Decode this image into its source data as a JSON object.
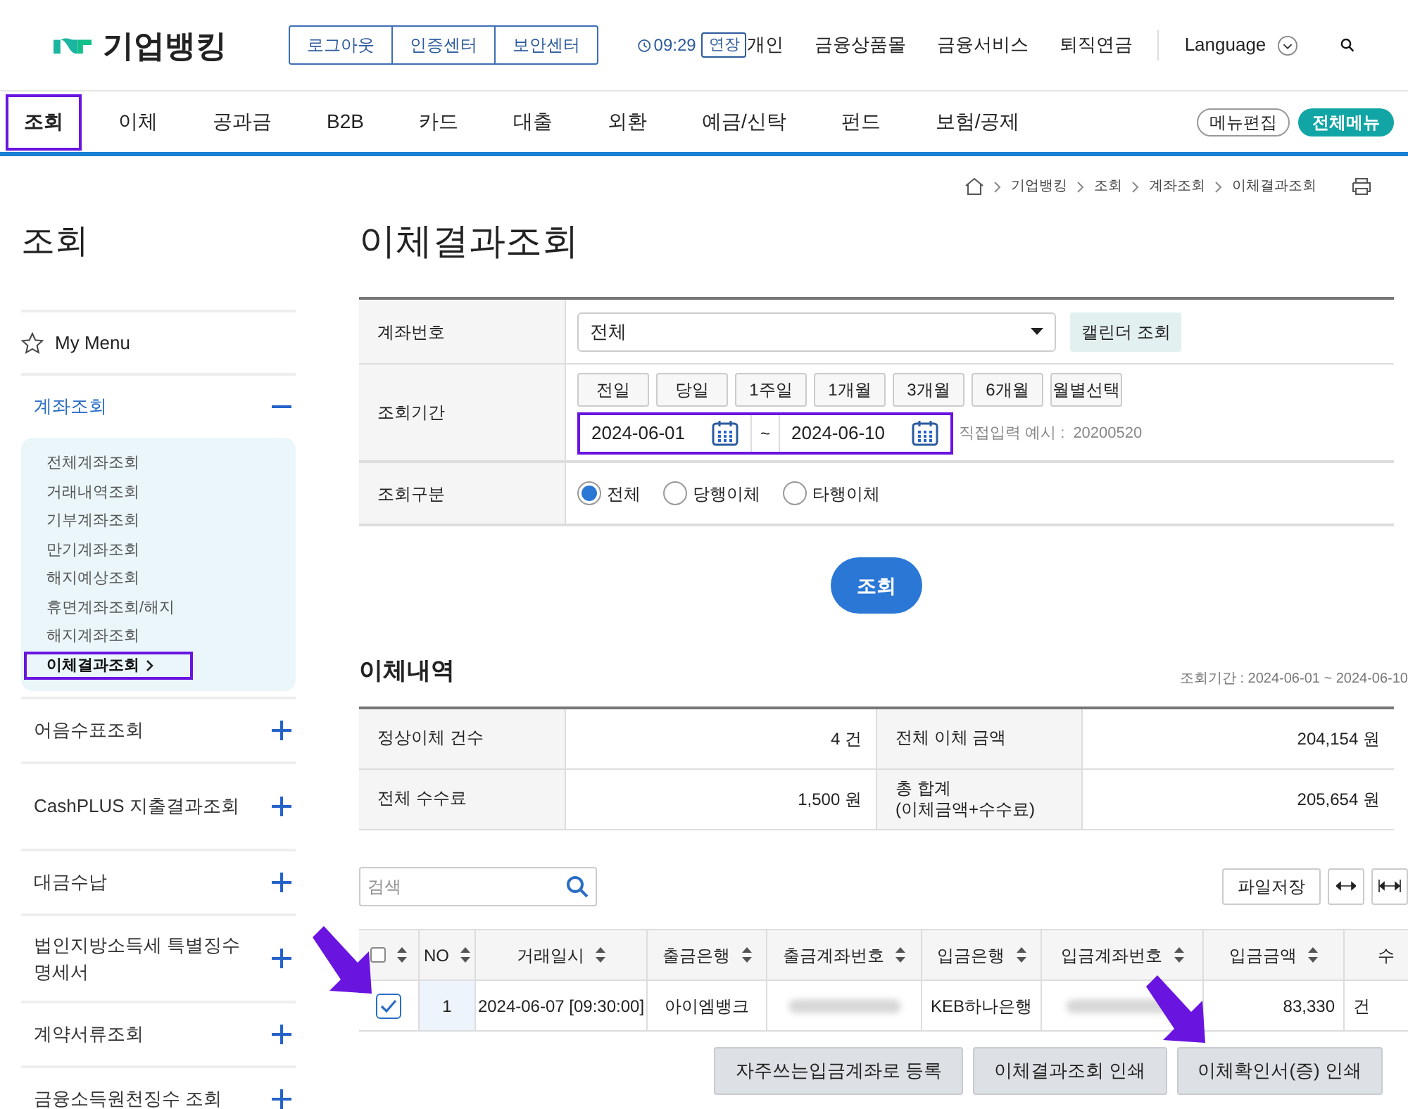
{
  "header": {
    "logo_text": "기업뱅킹",
    "session_buttons": [
      "로그아웃",
      "인증센터",
      "보안센터"
    ],
    "timer": "09:29",
    "extend": "연장",
    "links": [
      "개인",
      "금융상품몰",
      "금융서비스",
      "퇴직연금"
    ],
    "language": "Language"
  },
  "nav": {
    "tabs": [
      {
        "label": "조회",
        "selected": true,
        "highlighted": true
      },
      {
        "label": "이체",
        "selected": false,
        "highlighted": false
      },
      {
        "label": "공과금",
        "selected": false,
        "highlighted": false
      },
      {
        "label": "B2B",
        "selected": false,
        "highlighted": false
      },
      {
        "label": "카드",
        "selected": false,
        "highlighted": false
      },
      {
        "label": "대출",
        "selected": false,
        "highlighted": false
      },
      {
        "label": "외환",
        "selected": false,
        "highlighted": false
      },
      {
        "label": "예금/신탁",
        "selected": false,
        "highlighted": false
      },
      {
        "label": "펀드",
        "selected": false,
        "highlighted": false
      },
      {
        "label": "보험/공제",
        "selected": false,
        "highlighted": false
      }
    ],
    "edit_menu": "메뉴편집",
    "all_menu": "전체메뉴"
  },
  "breadcrumb": [
    "기업뱅킹",
    "조회",
    "계좌조회",
    "이체결과조회"
  ],
  "sidebar": {
    "title": "조회",
    "my_menu": "My Menu",
    "sections": [
      {
        "label": "계좌조회",
        "expanded": true,
        "children": [
          {
            "label": "전체계좌조회",
            "selected": false,
            "highlighted": false
          },
          {
            "label": "거래내역조회",
            "selected": false,
            "highlighted": false
          },
          {
            "label": "기부계좌조회",
            "selected": false,
            "highlighted": false
          },
          {
            "label": "만기계좌조회",
            "selected": false,
            "highlighted": false
          },
          {
            "label": "해지예상조회",
            "selected": false,
            "highlighted": false
          },
          {
            "label": "휴면계좌조회/해지",
            "selected": false,
            "highlighted": false
          },
          {
            "label": "해지계좌조회",
            "selected": false,
            "highlighted": false
          },
          {
            "label": "이체결과조회",
            "selected": true,
            "highlighted": true
          }
        ]
      },
      {
        "label": "어음수표조회",
        "expanded": false
      },
      {
        "label": "CashPLUS 지출결과조회",
        "expanded": false
      },
      {
        "label": "대금수납",
        "expanded": false
      },
      {
        "label": "법인지방소득세 특별징수명세서",
        "expanded": false
      },
      {
        "label": "계약서류조회",
        "expanded": false
      },
      {
        "label": "금융소득원천징수 조회",
        "expanded": false
      }
    ]
  },
  "page_title": "이체결과조회",
  "form": {
    "account": {
      "label": "계좌번호",
      "value": "전체",
      "calendar_button": "캘린더 조회"
    },
    "period": {
      "label": "조회기간",
      "quick_buttons": [
        "전일",
        "당일",
        "1주일",
        "1개월",
        "3개월",
        "6개월",
        "월별선택"
      ],
      "from": "2024-06-01",
      "separator": "~",
      "to": "2024-06-10",
      "highlighted": true,
      "hint": "직접입력 예시 :",
      "hint_example": "20200520"
    },
    "type": {
      "label": "조회구분",
      "options": [
        {
          "label": "전체",
          "selected": true
        },
        {
          "label": "당행이체",
          "selected": false
        },
        {
          "label": "타행이체",
          "selected": false
        }
      ]
    },
    "submit": "조회"
  },
  "results": {
    "title": "이체내역",
    "period_note": "조회기간 : 2024-06-01 ~ 2024-06-10",
    "summary": [
      [
        {
          "label": "정상이체 건수",
          "value": "4 건"
        },
        {
          "label": "전체 이체 금액",
          "value": "204,154 원"
        }
      ],
      [
        {
          "label": "전체 수수료",
          "value": "1,500 원"
        },
        {
          "label": "총 합계\n(이체금액+수수료)",
          "value": "205,654 원"
        }
      ]
    ],
    "search_placeholder": "검색",
    "save_button": "파일저장",
    "table": {
      "columns": [
        "NO",
        "거래일시",
        "출금은행",
        "출금계좌번호",
        "입금은행",
        "입금계좌번호",
        "입금금액",
        "수"
      ],
      "header_checked": false,
      "rows": [
        {
          "checked": true,
          "cells": [
            "1",
            "2024-06-07 [09:30:00]",
            "아이엠뱅크",
            null,
            "KEB하나은행",
            null,
            "83,330",
            "건"
          ]
        }
      ]
    },
    "actions": [
      "자주쓰는입금계좌로 등록",
      "이체결과조회 인쇄",
      "이체확인서(증) 인쇄"
    ]
  }
}
